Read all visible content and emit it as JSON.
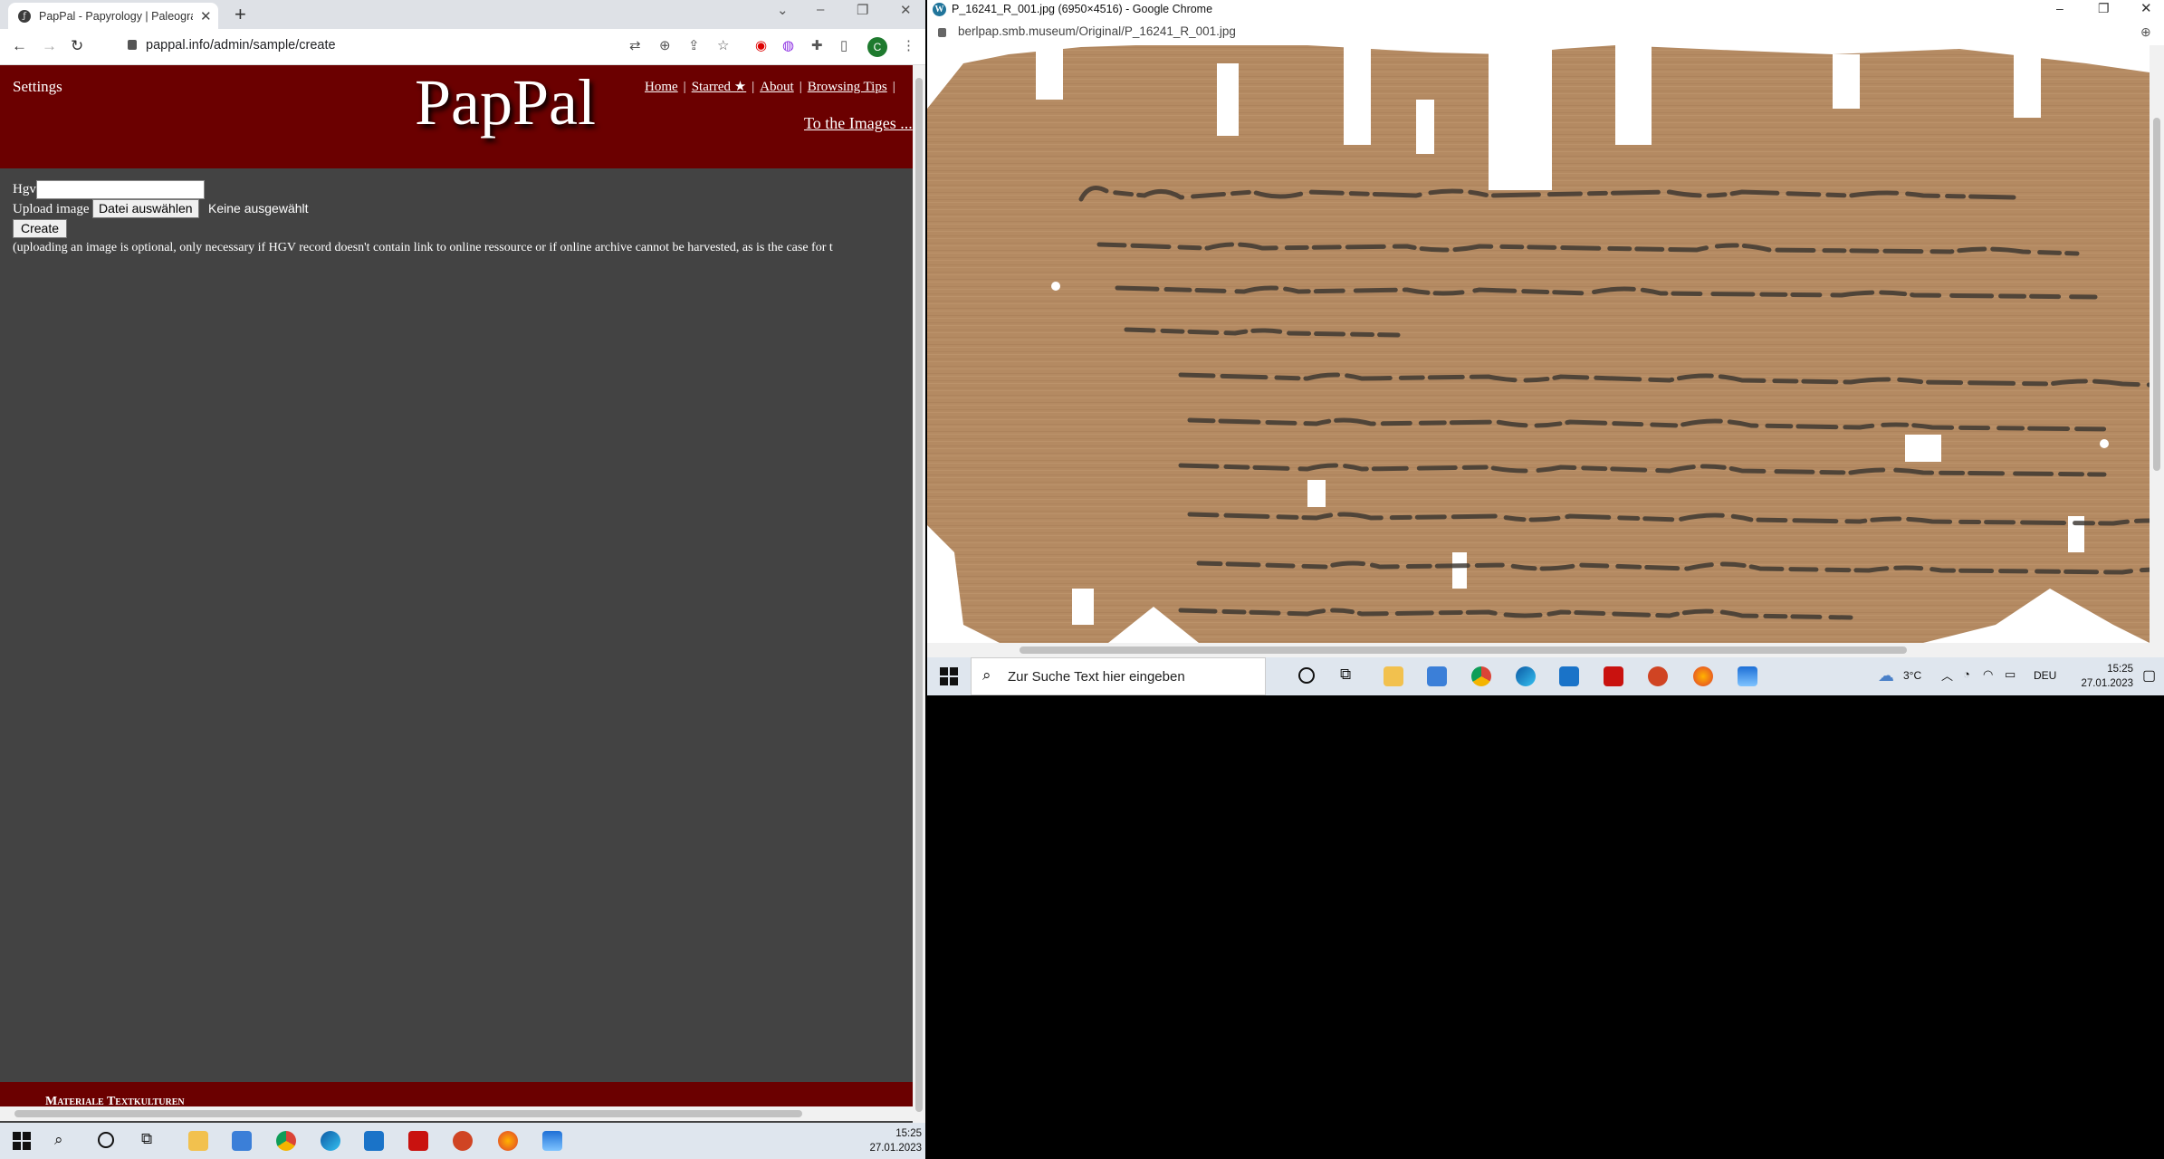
{
  "left_browser": {
    "tab_title": "PapPal - Papyrology | Paleography",
    "url": "pappal.info/admin/sample/create",
    "profile_initial": "C",
    "site": {
      "settings_label": "Settings",
      "logo": "PapPal",
      "nav": [
        "Home",
        "Starred ★",
        "About",
        "Browsing Tips"
      ],
      "to_images": "To the Images ..."
    },
    "form": {
      "hgv_label": "Hgv",
      "hgv_value": "",
      "upload_label": "Upload image",
      "file_button": "Datei auswählen",
      "no_file": "Keine ausgewählt",
      "create_button": "Create",
      "note": "(uploading an image is optional, only necessary if HGV record doesn't contain link to online ressource or if online archive cannot be harvested, as is the case for t"
    },
    "footer_text": "Materiale Textkulturen"
  },
  "left_taskbar": {
    "time": "15:25",
    "date": "27.01.2023"
  },
  "right_browser": {
    "window_title": "P_16241_R_001.jpg (6950×4516) - Google Chrome",
    "url": "berlpap.smb.museum/Original/P_16241_R_001.jpg"
  },
  "right_taskbar": {
    "search_placeholder": "Zur Suche Text hier eingeben",
    "weather": "3°C",
    "language": "DEU",
    "time": "15:25",
    "date": "27.01.2023"
  },
  "colors": {
    "header_red": "#6b0000",
    "page_bg": "#434343",
    "papyrus": "#b58a62",
    "ink": "#3a3530"
  },
  "icons": {
    "taskbar": [
      "windows-start-icon",
      "search-icon",
      "cortana-icon",
      "task-view-icon",
      "file-explorer-icon",
      "store-icon",
      "chrome-icon",
      "edge-icon",
      "mail-icon",
      "acrobat-icon",
      "powerpoint-icon",
      "firefox-icon",
      "photos-icon"
    ]
  }
}
